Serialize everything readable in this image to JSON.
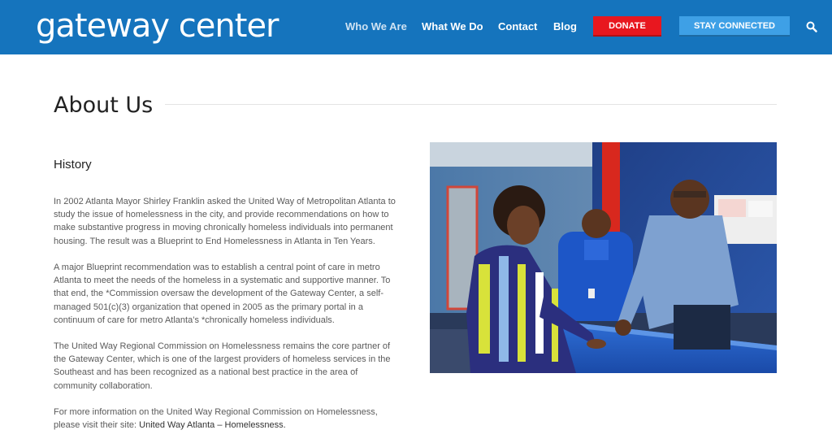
{
  "brand": {
    "logo_text": "gateway center"
  },
  "nav": {
    "items": [
      {
        "label": "Who We Are"
      },
      {
        "label": "What We Do"
      },
      {
        "label": "Contact"
      },
      {
        "label": "Blog"
      }
    ],
    "donate_label": "DONATE",
    "stay_connected_label": "STAY CONNECTED"
  },
  "main": {
    "title": "About Us",
    "section_heading": "History",
    "paragraphs": [
      "In 2002 Atlanta Mayor Shirley Franklin asked the United Way of Metropolitan Atlanta to study the issue of homelessness in the city, and provide recommendations on how to make substantive progress in moving chronically homeless individuals into permanent housing. The result was a Blueprint to End Homelessness in Atlanta in Ten Years.",
      "A major Blueprint recommendation was to establish a central point of care in metro Atlanta to meet the needs of the homeless in a systematic and supportive manner. To that end, the *Commission oversaw the development of the Gateway Center, a self-managed 501(c)(3) organization that opened in 2005 as the primary portal in a continuum of care for metro Atlanta’s *chronically homeless individuals.",
      "The United Way Regional Commission on Homelessness remains the core partner of the Gateway Center, which is one of the largest providers of homeless services in the Southeast and has been recognized as a national best practice in the area of community collaboration."
    ],
    "more_info_text": "For more information on the United Way Regional Commission on Homelessness, please visit their site: ",
    "more_info_link": "United Way Atlanta – Homelessness."
  },
  "colors": {
    "header_bg": "#1574bd",
    "donate_bg": "#e8171f",
    "stay_connected_bg": "#3ea0e6"
  },
  "icons": {
    "search": "search-icon"
  }
}
